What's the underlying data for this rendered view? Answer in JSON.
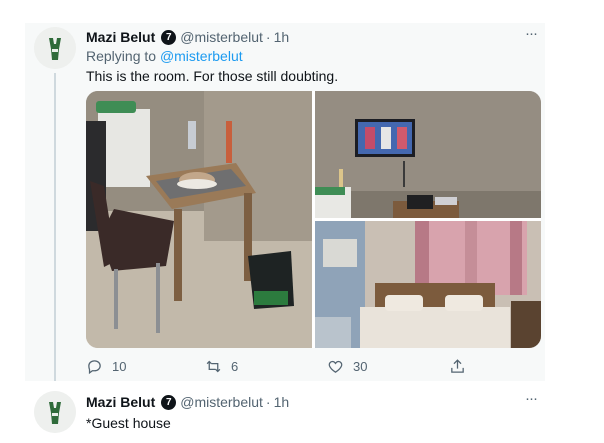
{
  "tweets": [
    {
      "name": "Mazi Belut",
      "badge": "7",
      "handle": "@misterbelut",
      "separator": "·",
      "time": "1h",
      "replying_prefix": "Replying to",
      "replying_handle": "@misterbelut",
      "text": "This is the room. For those still doubting.",
      "more": "···",
      "stats": {
        "replies": "10",
        "retweets": "6",
        "likes": "30"
      },
      "icons": [
        "reply-icon",
        "retweet-icon",
        "like-icon",
        "share-icon"
      ],
      "media": [
        "room-photo-desk-chair",
        "room-photo-tv",
        "room-photo-bed"
      ]
    },
    {
      "name": "Mazi Belut",
      "badge": "7",
      "handle": "@misterbelut",
      "separator": "·",
      "time": "1h",
      "text": "*Guest house",
      "more": "···"
    }
  ],
  "colors": {
    "link": "#1d9bf0",
    "secondary_text": "#536471",
    "primary_text": "#0f1419",
    "thread_line": "#cfd9de",
    "tweet_bg": "#f7f9f9"
  }
}
